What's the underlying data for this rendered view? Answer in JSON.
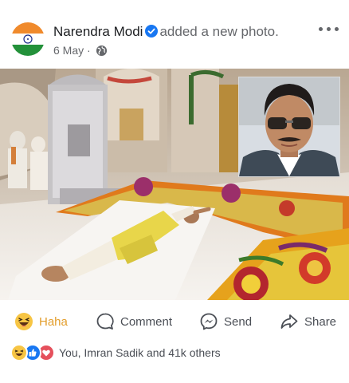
{
  "post": {
    "author": "Narendra Modi",
    "action": "added a new photo.",
    "date": "6 May",
    "separator": "·"
  },
  "actions": {
    "haha": "Haha",
    "comment": "Comment",
    "send": "Send",
    "share": "Share"
  },
  "reactions": {
    "summary": "You, Imran Sadik and 41k others",
    "icons": [
      "haha-reaction-icon",
      "like-reaction-icon",
      "love-reaction-icon"
    ]
  },
  "colors": {
    "verified": "#1877f2",
    "haha": "#f0a82c",
    "like": "#1877f2",
    "love": "#e5505c"
  }
}
